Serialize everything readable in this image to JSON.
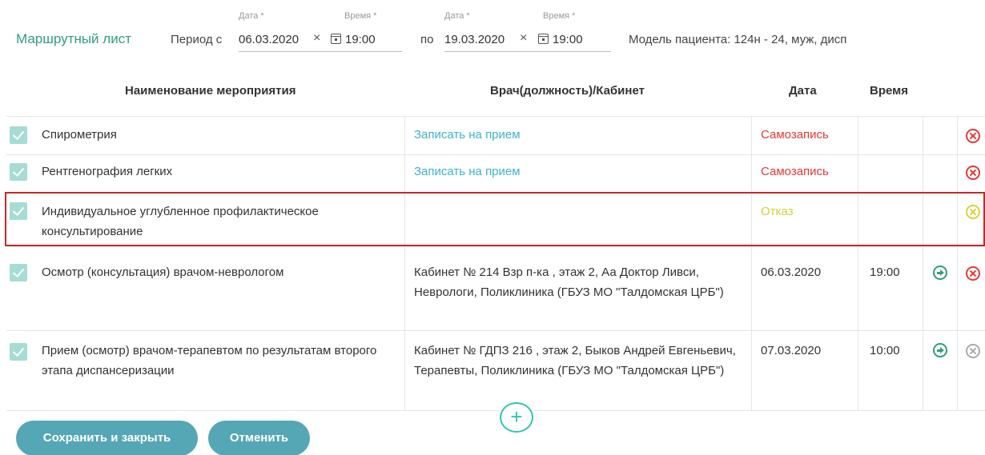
{
  "header": {
    "title": "Маршрутный лист",
    "period_from_label": "Период с",
    "period_to_label": "по",
    "date_from": {
      "caption": "Дата *",
      "value": "06.03.2020"
    },
    "time_from": {
      "caption": "Время *",
      "value": "19:00"
    },
    "date_to": {
      "caption": "Дата *",
      "value": "19.03.2020"
    },
    "time_to": {
      "caption": "Время *",
      "value": "19:00"
    },
    "clear_glyph": "×",
    "patient_model": "Модель пациента: 124н - 24, муж, дисп"
  },
  "table": {
    "columns": [
      "Наименование мероприятия",
      "Врач(должность)/Кабинет",
      "Дата",
      "Время"
    ],
    "rows": [
      {
        "name": "Спирометрия",
        "doctor": "Записать на прием",
        "date": "Самозапись",
        "time": "",
        "checked": true,
        "remove_icon": "close-circle-red"
      },
      {
        "name": "Рентгенография легких",
        "doctor": "Записать на прием",
        "date": "Самозапись",
        "time": "",
        "checked": true,
        "remove_icon": "close-circle-red"
      },
      {
        "name": "Индивидуальное углубленное профилактическое консультирование",
        "doctor": "",
        "date": "Отказ",
        "time": "",
        "checked": true,
        "remove_icon": "close-circle-yellow",
        "highlighted": true
      },
      {
        "name": "Осмотр (консультация) врачом-неврологом",
        "doctor": "Кабинет № 214 Взр п-ка , этаж 2, Аа Доктор Ливси, Неврологи, Поликлиника (ГБУЗ МО \"Талдомская ЦРБ\")",
        "date": "06.03.2020",
        "time": "19:00",
        "checked": true,
        "go_icon": "arrow-circle-right",
        "remove_icon": "close-circle-red"
      },
      {
        "name": "Прием (осмотр) врачом-терапевтом по результатам второго этапа диспансеризации",
        "doctor": "Кабинет № ГДПЗ 216 , этаж 2, Быков Андрей Евгеньевич, Терапевты, Поликлиника (ГБУЗ МО \"Талдомская ЦРБ\")",
        "date": "07.03.2020",
        "time": "10:00",
        "checked": true,
        "go_icon": "arrow-circle-right",
        "remove_icon": "close-circle-grey"
      }
    ]
  },
  "add_glyph": "+",
  "buttons": {
    "save_close": "Сохранить и закрыть",
    "cancel": "Отменить"
  },
  "colors": {
    "accent": "#2f9e7e",
    "link": "#3db3c9",
    "danger": "#e53935",
    "warning": "#d4cf3a",
    "button": "#55a7b6",
    "highlight_border": "#c62828"
  }
}
